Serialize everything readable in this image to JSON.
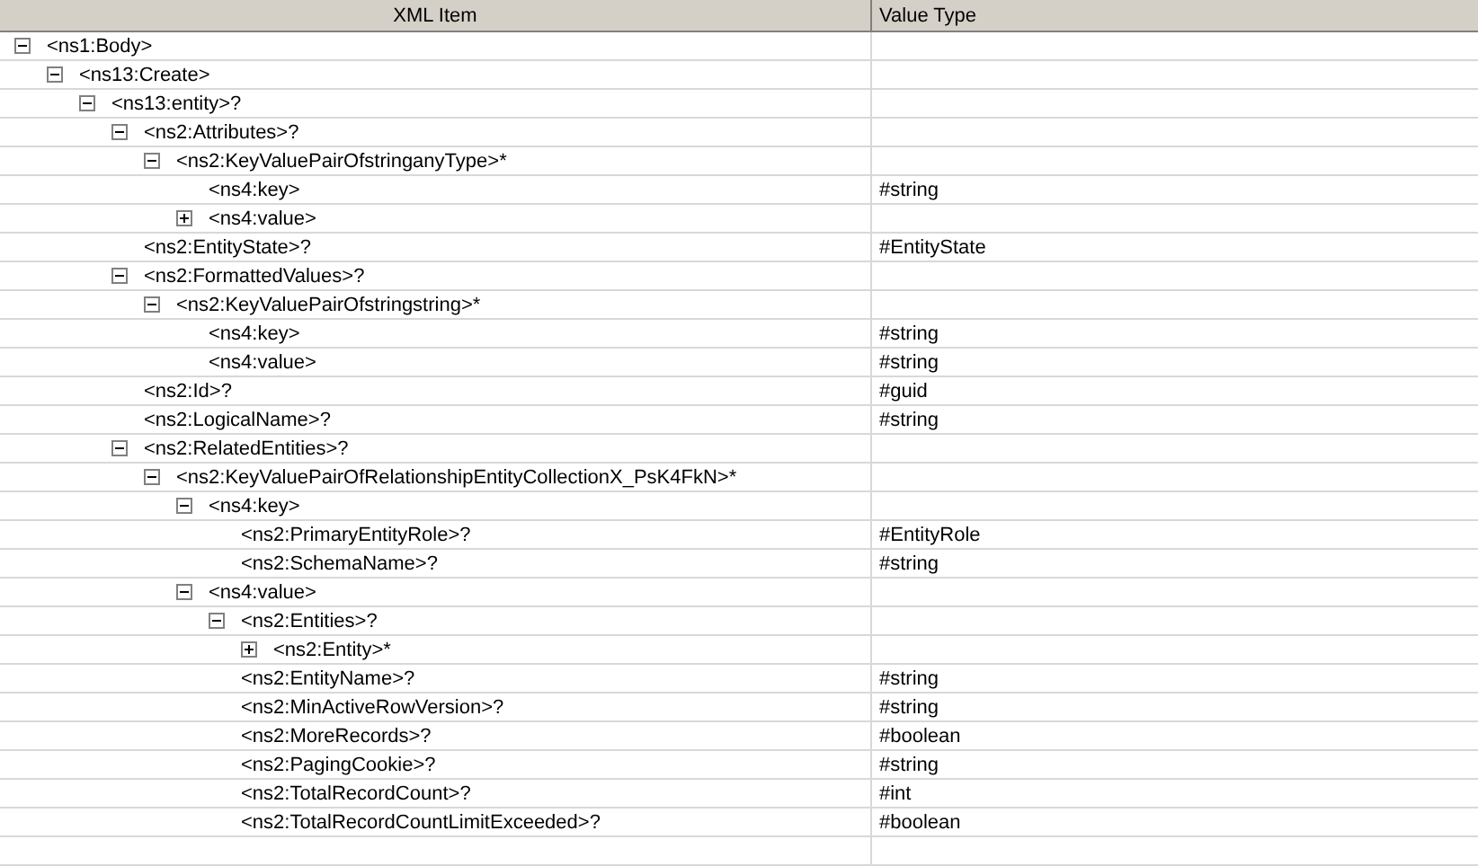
{
  "columns": [
    "XML Item",
    "Value Type"
  ],
  "tree": [
    {
      "label": "<ns1:Body>",
      "expanded": true,
      "children": [
        {
          "label": "<ns13:Create>",
          "expanded": true,
          "children": [
            {
              "label": "<ns13:entity>?",
              "expanded": true,
              "children": [
                {
                  "label": "<ns2:Attributes>?",
                  "expanded": true,
                  "children": [
                    {
                      "label": "<ns2:KeyValuePairOfstringanyType>*",
                      "expanded": true,
                      "children": [
                        {
                          "label": "<ns4:key>",
                          "type": "#string"
                        },
                        {
                          "label": "<ns4:value>",
                          "expanded": false
                        }
                      ]
                    }
                  ]
                },
                {
                  "label": "<ns2:EntityState>?",
                  "type": "#EntityState"
                },
                {
                  "label": "<ns2:FormattedValues>?",
                  "expanded": true,
                  "children": [
                    {
                      "label": "<ns2:KeyValuePairOfstringstring>*",
                      "expanded": true,
                      "children": [
                        {
                          "label": "<ns4:key>",
                          "type": "#string"
                        },
                        {
                          "label": "<ns4:value>",
                          "type": "#string"
                        }
                      ]
                    }
                  ]
                },
                {
                  "label": "<ns2:Id>?",
                  "type": "#guid"
                },
                {
                  "label": "<ns2:LogicalName>?",
                  "type": "#string"
                },
                {
                  "label": "<ns2:RelatedEntities>?",
                  "expanded": true,
                  "children": [
                    {
                      "label": "<ns2:KeyValuePairOfRelationshipEntityCollectionX_PsK4FkN>*",
                      "expanded": true,
                      "children": [
                        {
                          "label": "<ns4:key>",
                          "expanded": true,
                          "children": [
                            {
                              "label": "<ns2:PrimaryEntityRole>?",
                              "type": "#EntityRole"
                            },
                            {
                              "label": "<ns2:SchemaName>?",
                              "type": "#string"
                            }
                          ]
                        },
                        {
                          "label": "<ns4:value>",
                          "expanded": true,
                          "children": [
                            {
                              "label": "<ns2:Entities>?",
                              "expanded": true,
                              "children": [
                                {
                                  "label": "<ns2:Entity>*",
                                  "expanded": false
                                }
                              ]
                            },
                            {
                              "label": "<ns2:EntityName>?",
                              "type": "#string"
                            },
                            {
                              "label": "<ns2:MinActiveRowVersion>?",
                              "type": "#string"
                            },
                            {
                              "label": "<ns2:MoreRecords>?",
                              "type": "#boolean"
                            },
                            {
                              "label": "<ns2:PagingCookie>?",
                              "type": "#string"
                            },
                            {
                              "label": "<ns2:TotalRecordCount>?",
                              "type": "#int"
                            },
                            {
                              "label": "<ns2:TotalRecordCountLimitExceeded>?",
                              "type": "#boolean"
                            }
                          ]
                        }
                      ]
                    }
                  ]
                }
              ]
            }
          ]
        }
      ]
    }
  ]
}
